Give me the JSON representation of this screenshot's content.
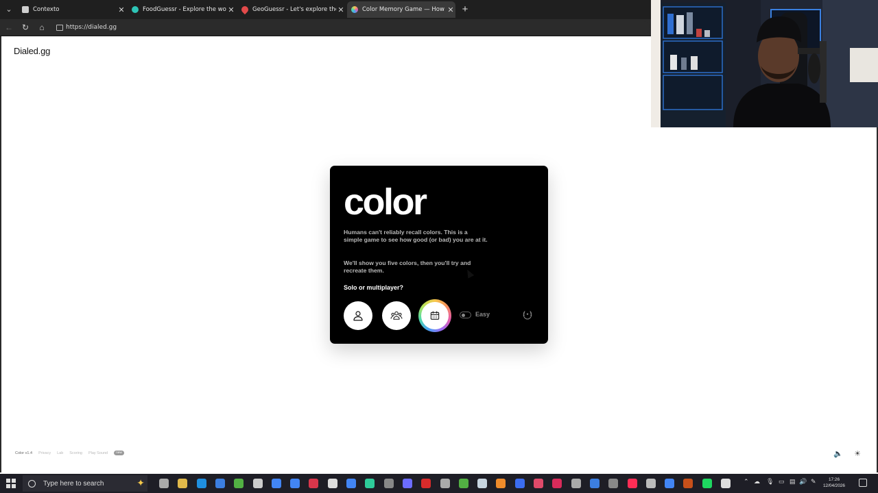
{
  "browser": {
    "tabs": [
      {
        "title": "Contexto",
        "color": "#cfcfcf"
      },
      {
        "title": "FoodGuessr - Explore the world by",
        "color": "#2ec4b6"
      },
      {
        "title": "GeoGuessr - Let's explore the wor",
        "color": "#e24a4a"
      },
      {
        "title": "Color Memory Game — How Well",
        "color": "#c86ce0"
      }
    ],
    "url": "https://dialed.gg"
  },
  "page": {
    "logo": "Dialed.gg",
    "card": {
      "title": "color",
      "para1": "Humans can't reliably recall colors. This is a simple game to see how good (or bad) you are at it.",
      "para2": "We'll show you five colors, then you'll try and recreate them.",
      "question": "Solo or multiplayer?",
      "toggle_label": "Easy"
    },
    "footer": {
      "version": "Color v1.4",
      "links": [
        "Privacy",
        "Lab",
        "Scoring",
        "Play Sound"
      ],
      "badge": "new"
    }
  },
  "taskbar": {
    "search_placeholder": "Type here to search",
    "time": "17:26",
    "date": "12/04/2026",
    "app_colors": [
      "#aaaaaa",
      "#e0b84a",
      "#1f8fe0",
      "#3c7ee0",
      "#52b043",
      "#cccccc",
      "#4285f4",
      "#4285f4",
      "#d9364b",
      "#dddddd",
      "#4285f4",
      "#2ecc9a",
      "#888888",
      "#6c6cff",
      "#d92b2b",
      "#aaaaaa",
      "#52b043",
      "#c7d5e0",
      "#f08c2b",
      "#3b6cf0",
      "#e04a6a",
      "#d92b5a",
      "#aaaaaa",
      "#3c7ee0",
      "#888888",
      "#ff2d55",
      "#bbbbbb",
      "#4285f4",
      "#c8501a",
      "#1ed760",
      "#dddddd"
    ]
  }
}
